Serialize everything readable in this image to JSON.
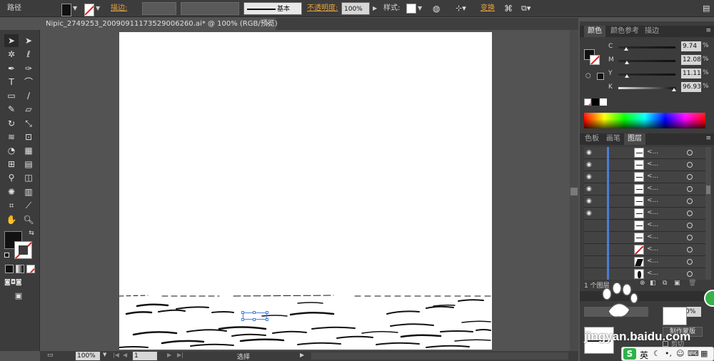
{
  "control_bar": {
    "object_type": "路径",
    "stroke_label": "描边:",
    "stroke_profile": "基本",
    "opacity_label": "不透明度:",
    "opacity_value": "100%",
    "style_label": "样式:",
    "transform_label": "变换"
  },
  "document_tab": {
    "title": "Nipic_2749253_20090911173529006260.ai* @ 100% (RGB/预览)",
    "close": "×"
  },
  "status_bar": {
    "zoom": "100%",
    "page": "1",
    "tool_status": "选择"
  },
  "color_panel": {
    "tabs": [
      "颜色",
      "颜色参考",
      "描边"
    ],
    "active_tab": "颜色",
    "channels": [
      {
        "letter": "C",
        "value": "9.74",
        "fraction": 0.1
      },
      {
        "letter": "M",
        "value": "12.08",
        "fraction": 0.12
      },
      {
        "letter": "Y",
        "value": "11.11",
        "fraction": 0.11
      },
      {
        "letter": "K",
        "value": "96.93",
        "fraction": 0.97
      }
    ],
    "unit": "%"
  },
  "layers_panel": {
    "tabs": [
      "色板",
      "画笔",
      "图层"
    ],
    "active_tab": "图层",
    "row_name": "<...",
    "rows": 11,
    "footer": "1 个图层"
  },
  "transparency_panel": {
    "make_mask_button": "制作蒙版",
    "clip_label": "剪切",
    "opacity_value": "0%"
  },
  "watermark": {
    "text": "jingyan.baidu.com"
  },
  "ime": {
    "mode": "英"
  },
  "colors": {
    "fill": "#111111",
    "selection": "#4a7fd6",
    "accent_label": "#e8a33a"
  }
}
